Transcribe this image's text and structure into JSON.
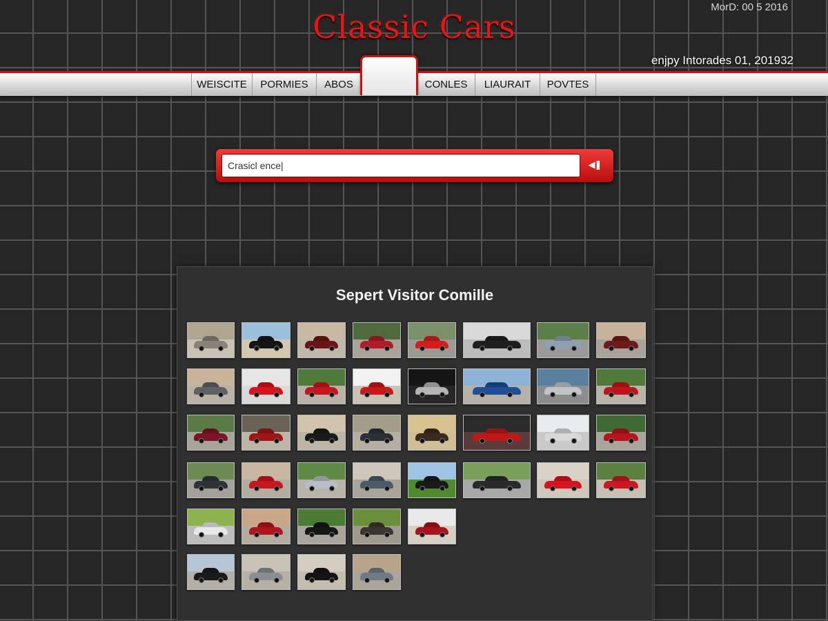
{
  "header": {
    "title": "Classic Cars",
    "date": "MorD: 00 5 2016",
    "tagline": "enjpy Intorades 01, 201932"
  },
  "nav": {
    "tabs": [
      {
        "label": "WEISCITE",
        "name": "tab-weiscite"
      },
      {
        "label": "PORMIES",
        "name": "tab-pormies"
      },
      {
        "label": "ABOS",
        "name": "tab-abos"
      },
      {
        "label": "CONLES",
        "name": "tab-conles"
      },
      {
        "label": "LIAURAIT",
        "name": "tab-liaurait"
      },
      {
        "label": "POVTES",
        "name": "tab-povtes"
      }
    ]
  },
  "search": {
    "value": "Crasicl ence|",
    "button_icon": "rewind-icon",
    "button_glyph": "◀❚"
  },
  "gallery": {
    "title": "Sepert Visitor Comille",
    "rows": [
      [
        {
          "car": "#8a8278",
          "bg": "#b0a590",
          "ground": "#c9c3b6"
        },
        {
          "car": "#151515",
          "bg": "#9cbfdd",
          "ground": "#d3c7b0"
        },
        {
          "car": "#6b1414",
          "bg": "#c8b8a4",
          "ground": "#bfb8ad"
        },
        {
          "car": "#b01c2a",
          "bg": "#4f6a3d",
          "ground": "#a9a39a"
        },
        {
          "car": "#d61b1b",
          "bg": "#7a8f6a",
          "ground": "#9a9a96"
        },
        {
          "car": "#1e1e1e",
          "bg": "#d9d9d9",
          "ground": "#bcbcbc"
        },
        {
          "car": "#8fa0b4",
          "bg": "#5c7f4a",
          "ground": "#9a9a9a"
        },
        {
          "car": "#6e1a1a",
          "bg": "#c7b39a",
          "ground": "#a8a49c"
        }
      ],
      [
        {
          "car": "#5e6166",
          "bg": "#c9b49a",
          "ground": "#b9b2a6"
        },
        {
          "car": "#d6141e",
          "bg": "#e6e6e6",
          "ground": "#dadada"
        },
        {
          "car": "#c8141e",
          "bg": "#4f7a3a",
          "ground": "#b8b3a6"
        },
        {
          "car": "#c81818",
          "bg": "#f2f2f2",
          "ground": "#c9c2b5"
        },
        {
          "car": "#b5b5b5",
          "bg": "#151515",
          "ground": "#262626"
        },
        {
          "car": "#1e4e96",
          "bg": "#8fb3d6",
          "ground": "#b6b1a7"
        },
        {
          "car": "#c0c4c8",
          "bg": "#5b7f9e",
          "ground": "#8d8d8d"
        },
        {
          "car": "#c0141c",
          "bg": "#4f7a3a",
          "ground": "#b9b4a8"
        }
      ],
      [
        {
          "car": "#7a1426",
          "bg": "#5a7a46",
          "ground": "#a7a49c"
        },
        {
          "car": "#9e1616",
          "bg": "#6b6256",
          "ground": "#bcb5a8"
        },
        {
          "car": "#1a1a1a",
          "bg": "#d2c3ad",
          "ground": "#bdb6a8"
        },
        {
          "car": "#2a2f38",
          "bg": "#a39d8a",
          "ground": "#b5afa3"
        },
        {
          "car": "#3a2a20",
          "bg": "#d8c28f",
          "ground": "#d0be96"
        },
        {
          "car": "#c01818",
          "bg": "#2a2a2a",
          "ground": "#5a3a3a"
        },
        {
          "car": "#d9d9d9",
          "bg": "#e8ecef",
          "ground": "#c9c9c9"
        },
        {
          "car": "#b8141e",
          "bg": "#3f6a34",
          "ground": "#aaa59a"
        }
      ],
      [
        {
          "car": "#2f3338",
          "bg": "#6d8a54",
          "ground": "#a4a19a"
        },
        {
          "car": "#c6161e",
          "bg": "#c8b7a2",
          "ground": "#b4ada2"
        },
        {
          "car": "#b9bec4",
          "bg": "#5e8a46",
          "ground": "#b9b4aa"
        },
        {
          "car": "#4a5a66",
          "bg": "#cfc7ba",
          "ground": "#aaa59b"
        },
        {
          "car": "#1a1a1a",
          "bg": "#9fc3e2",
          "ground": "#4e8a2e"
        },
        {
          "car": "#2a2a2a",
          "bg": "#7aa05a",
          "ground": "#a8a8a8"
        },
        {
          "car": "#d8121e",
          "bg": "#d9d2c6",
          "ground": "#cfc8bc"
        },
        {
          "car": "#cc1620",
          "bg": "#5b8040",
          "ground": "#c6c0b4"
        }
      ],
      [
        {
          "car": "#e8e8e8",
          "bg": "#8db24e",
          "ground": "#bdbdbd"
        },
        {
          "car": "#b0141c",
          "bg": "#caa78a",
          "ground": "#b3aca0"
        },
        {
          "car": "#161616",
          "bg": "#4b7a34",
          "ground": "#a9a59c"
        },
        {
          "car": "#3a3530",
          "bg": "#6a8f3a",
          "ground": "#9e9a8e"
        },
        {
          "car": "#a8141e",
          "bg": "#e9e9e9",
          "ground": "#d6d0c4"
        }
      ],
      [
        {
          "car": "#1a1a1a",
          "bg": "#b6c6d6",
          "ground": "#b3b0a8"
        },
        {
          "car": "#8a8e94",
          "bg": "#c9c2b6",
          "ground": "#b7b1a5"
        },
        {
          "car": "#141414",
          "bg": "#d3cdc2",
          "ground": "#c4beb2"
        },
        {
          "car": "#707a84",
          "bg": "#b7a48a",
          "ground": "#aaa59b"
        }
      ]
    ]
  }
}
